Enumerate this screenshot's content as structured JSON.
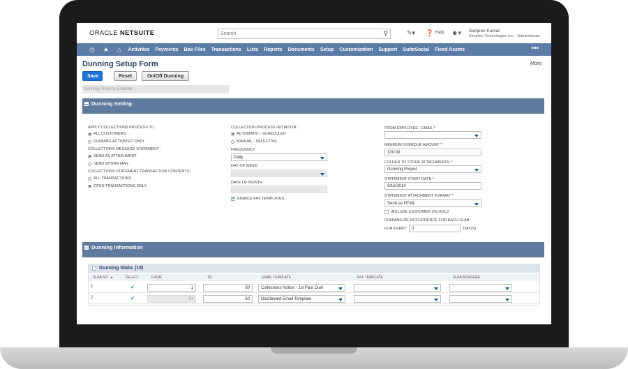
{
  "header": {
    "logo_oracle": "ORACLE",
    "logo_netsuite": "NETSUITE",
    "search_placeholder": "Search",
    "help_label": "Help",
    "user_name": "Sanjeev Kumar",
    "user_role": "Simplion Technologies Inc. - Administrator"
  },
  "nav": {
    "items": [
      "Activities",
      "Payments",
      "Box Files",
      "Transactions",
      "Lists",
      "Reports",
      "Documents",
      "Setup",
      "Customization",
      "Support",
      "SuiteSocial",
      "Fixed Assets"
    ],
    "more": "•••"
  },
  "page": {
    "title": "Dunning Setup Form",
    "more_link": "More",
    "buttons": {
      "save": "Save",
      "reset": "Reset",
      "onoff": "On/Off Dunning"
    },
    "status": "Dunning Process Enabled"
  },
  "dunning_setting": {
    "section_label": "Dunning Setting",
    "apply_label": "APPLY COLLECTIONS PROCESS TO :",
    "apply_opt1": "ALL CUSTOMERS",
    "apply_opt2": "DUNNING ACTIVATED ONLY",
    "msg_label": "COLLECTIONS MESSAGE STATEMENT :",
    "msg_opt1": "SEND AS ATTACHMENT",
    "msg_opt2": "SEND WITHIN MAIL",
    "contents_label": "COLLECTIONS STATEMENT TRANSACTION CONTENTS :",
    "contents_opt1": "ALL TRANSACTIONS",
    "contents_opt2": "OPEN TRANSACTIONS ONLY",
    "initiation_label": "COLLECTION PROCESS INITIATION :",
    "initiation_opt1": "AUTOMATIC - SCHEDULED",
    "initiation_opt2": "MANUAL - SELECTIVE",
    "frequency_label": "FREQUENCY",
    "frequency_value": "Daily",
    "day_of_week_label": "DAY OF WEEK",
    "date_of_month_label": "DATE OF MONTH",
    "fax_label": "ENABLE FAX TEMPLATES",
    "from_employee_label": "FROM EMPLOYEE - EMAIL",
    "min_overdue_label": "MINIMUM OVERDUE AMOUNT",
    "min_overdue_value": "100.00",
    "folder_label": "FOLDER TO STORE ATTACHMENTS",
    "folder_value": "Dunning Project",
    "start_date_label": "STATEMENT START DATE",
    "start_date_value": "9/16/2014",
    "format_label": "STATEMENT ATTACHMENT FORMAT",
    "format_value": "Send as HTML",
    "include_hold_label": "INCLUDE CUSTOMER ON HOLD",
    "reoccurrence_label": "DUNNING RE-OCCURRENCE FOR EACH SLAB",
    "for_every_label": "FOR EVERY",
    "for_every_value": "0",
    "days_label": "DAY(S)",
    "required_mark": "*"
  },
  "dunning_information": {
    "section_label": "Dunning Information",
    "slabs_title": "Dunning Slabs (15)",
    "columns": [
      "SLAB NO. ▲",
      "SELECT",
      "FROM",
      "TO",
      "EMAIL TEMPLATE",
      "FAX TEMPLATE",
      "SLAB ASSIGNEE"
    ],
    "rows": [
      {
        "no": "1",
        "select": "✔",
        "from": "1",
        "to": "30",
        "email": "Collections Notice - 1st Past Due!"
      },
      {
        "no": "2",
        "select": "✔",
        "from": "31",
        "to": "60",
        "email": "Dashboard Email Template"
      }
    ]
  }
}
